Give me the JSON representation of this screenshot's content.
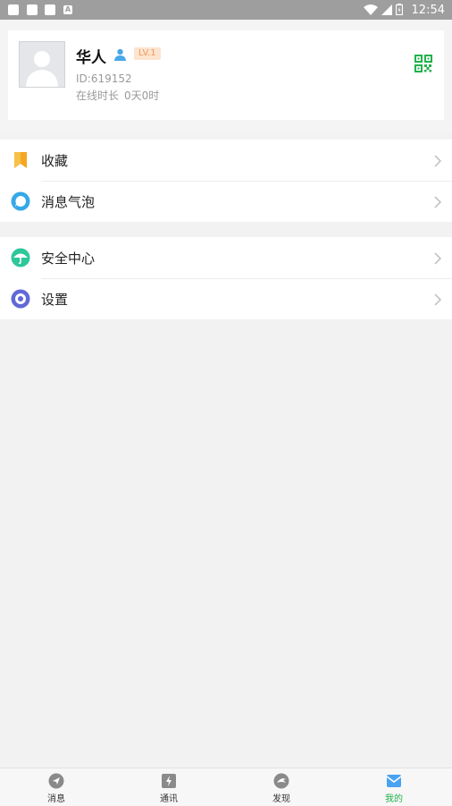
{
  "status_bar": {
    "time": "12:54",
    "left_icons": [
      "notification-square",
      "notification-square",
      "notification-square",
      "a-icon"
    ],
    "right_icons": [
      "wifi-icon",
      "signal-icon",
      "battery-icon"
    ],
    "a_glyph": "A"
  },
  "profile": {
    "nickname": "华人",
    "level": "LV.1",
    "id_text": "ID:619152",
    "online_label": "在线时长",
    "online_value": "0天0时",
    "qr_icon": "qr-code-icon",
    "accent_color": "#22b14c"
  },
  "menu": {
    "group1": [
      {
        "label": "收藏",
        "icon": "bookmark-icon",
        "color": "#f5a623"
      },
      {
        "label": "消息气泡",
        "icon": "chat-bubble-icon",
        "color": "#36a8e8"
      }
    ],
    "group2": [
      {
        "label": "安全中心",
        "icon": "umbrella-icon",
        "color": "#2ec79a"
      },
      {
        "label": "设置",
        "icon": "settings-icon",
        "color": "#6169d8"
      }
    ]
  },
  "bottom_nav": {
    "tabs": [
      {
        "label": "消息",
        "icon": "send-icon",
        "active": false
      },
      {
        "label": "通讯",
        "icon": "lightning-icon",
        "active": false
      },
      {
        "label": "发现",
        "icon": "discover-icon",
        "active": false
      },
      {
        "label": "我的",
        "icon": "mail-icon",
        "active": true
      }
    ],
    "active_color": "#22b14c"
  }
}
